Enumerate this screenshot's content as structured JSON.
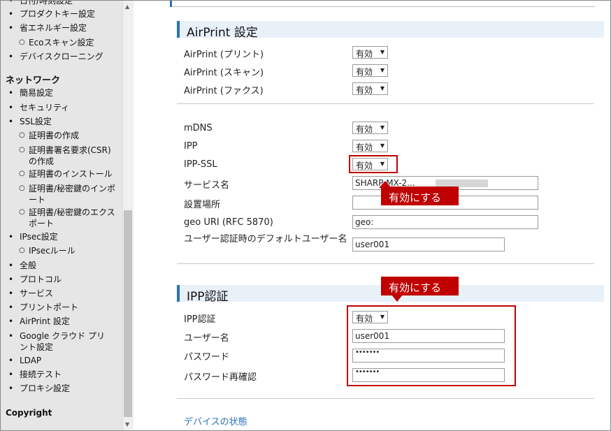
{
  "sidebar": {
    "items_top": [
      {
        "label": "日付/時刻設定",
        "sub": false
      },
      {
        "label": "プロダクトキー設定",
        "sub": false
      },
      {
        "label": "省エネルギー設定",
        "sub": false
      },
      {
        "label": "Ecoスキャン設定",
        "sub": true
      },
      {
        "label": "デバイスクローニング",
        "sub": false
      }
    ],
    "network_heading": "ネットワーク",
    "network_items": [
      {
        "label": "簡易設定",
        "sub": false
      },
      {
        "label": "セキュリティ",
        "sub": false
      },
      {
        "label": "SSL設定",
        "sub": false
      },
      {
        "label": "証明書の作成",
        "sub": true
      },
      {
        "label": "証明書署名要求(CSR)の作成",
        "sub": true
      },
      {
        "label": "証明書のインストール",
        "sub": true
      },
      {
        "label": "証明書/秘密鍵のインポート",
        "sub": true
      },
      {
        "label": "証明書/秘密鍵のエクスポート",
        "sub": true
      },
      {
        "label": "IPsec設定",
        "sub": false
      },
      {
        "label": "IPsecルール",
        "sub": true
      },
      {
        "label": "全般",
        "sub": false
      },
      {
        "label": "プロトコル",
        "sub": false
      },
      {
        "label": "サービス",
        "sub": false
      },
      {
        "label": "プリントポート",
        "sub": false
      },
      {
        "label": "AirPrint 設定",
        "sub": false
      },
      {
        "label": "Google クラウド プリント設定",
        "sub": false
      },
      {
        "label": "LDAP",
        "sub": false
      },
      {
        "label": "接続テスト",
        "sub": false
      },
      {
        "label": "プロキシ設定",
        "sub": false
      }
    ],
    "copyright": "Copyright"
  },
  "airprint": {
    "title": "AirPrint 設定",
    "print_label": "AirPrint (プリント)",
    "print_value": "有効",
    "scan_label": "AirPrint (スキャン)",
    "scan_value": "有効",
    "fax_label": "AirPrint (ファクス)",
    "fax_value": "有効",
    "mdns_label": "mDNS",
    "mdns_value": "有効",
    "ipp_label": "IPP",
    "ipp_value": "有効",
    "ippssl_label": "IPP-SSL",
    "ippssl_value": "有効",
    "service_label": "サービス名",
    "service_value": "SHARP MX-2...",
    "location_label": "設置場所",
    "location_value": "",
    "geo_label": "geo URI (RFC 5870)",
    "geo_value": "geo:",
    "default_user_label": "ユーザー認証時のデフォルトユーザー名",
    "default_user_value": "user001"
  },
  "ipp_auth": {
    "title": "IPP認証",
    "auth_label": "IPP認証",
    "auth_value": "有効",
    "user_label": "ユーザー名",
    "user_value": "user001",
    "password_label": "パスワード",
    "password_value": "•••••••",
    "password_confirm_label": "パスワード再確認",
    "password_confirm_value": "•••••••"
  },
  "annotations": {
    "callout1": "有効にする",
    "callout2": "有効にする",
    "color": "#c00000"
  },
  "footer_link": "デバイスの状態",
  "colors": {
    "accent": "#2a72b5",
    "section_bg": "#e8f0f8",
    "sidebar_bg": "#e6e6e6"
  }
}
